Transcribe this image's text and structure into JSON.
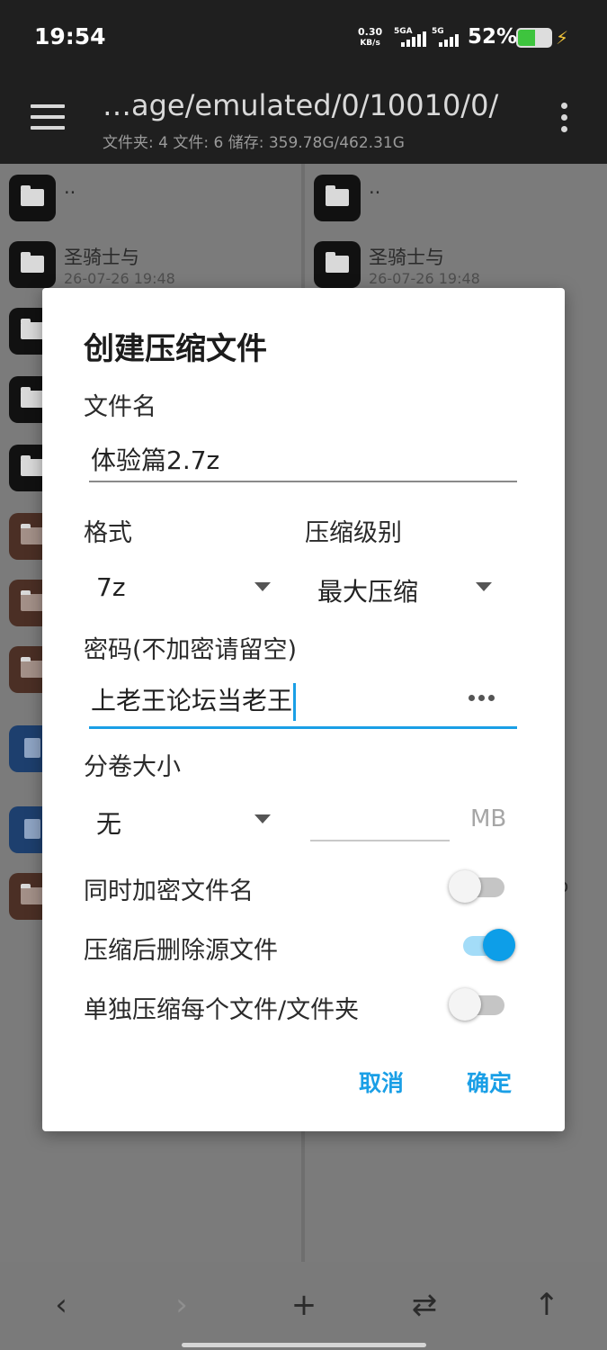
{
  "status_bar": {
    "time": "19:54",
    "net_speed_value": "0.30",
    "net_speed_unit": "KB/s",
    "signal1_label": "5GA",
    "signal2_label": "5G",
    "battery_pct": "52%",
    "battery_level": 0.52
  },
  "toolbar": {
    "path": "…age/emulated/0/10010/0/",
    "info": "文件夹: 4  文件: 6  储存: 359.78G/462.31G"
  },
  "left_pane": {
    "items": [
      {
        "name": "..",
        "date": ""
      },
      {
        "name": "圣骑士与",
        "date": "26-07-26 19:48"
      }
    ]
  },
  "right_pane": {
    "items": [
      {
        "name": "..",
        "date": ""
      },
      {
        "name": "圣骑士与",
        "date": "26-07-26 19:48"
      }
    ],
    "stray_text": "o"
  },
  "dialog": {
    "title": "创建压缩文件",
    "filename_label": "文件名",
    "filename_value": "体验篇2.7z",
    "format_label": "格式",
    "format_value": "7z",
    "level_label": "压缩级别",
    "level_value": "最大压缩",
    "password_label": "密码(不加密请留空)",
    "password_value": "上老王论坛当老王",
    "split_label": "分卷大小",
    "split_value": "无",
    "split_unit": "MB",
    "encrypt_names_label": "同时加密文件名",
    "encrypt_names_on": false,
    "delete_source_label": "压缩后删除源文件",
    "delete_source_on": true,
    "separate_label": "单独压缩每个文件/文件夹",
    "separate_on": false,
    "cancel_label": "取消",
    "ok_label": "确定",
    "accent": "#1a9fe6"
  },
  "bottom_nav": {
    "back": "‹",
    "forward": "›",
    "add": "+",
    "swap": "⇄",
    "up": "↑"
  }
}
